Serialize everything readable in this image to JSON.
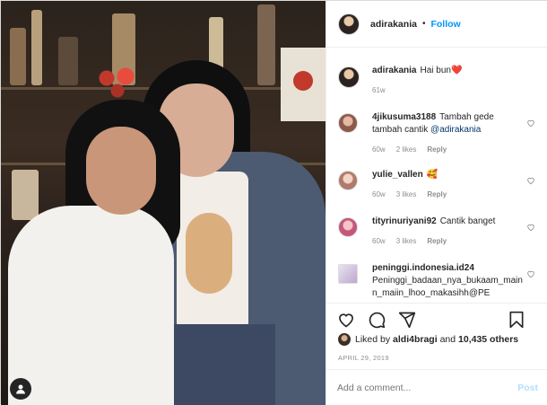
{
  "header": {
    "username": "adirakania",
    "separator": "•",
    "follow_label": "Follow"
  },
  "caption": {
    "username": "adirakania",
    "text": "Hai bun",
    "emoji": "❤️",
    "time": "61w"
  },
  "comments": [
    {
      "username": "4jikusuma3188",
      "text": "Tambah gede tambah cantik",
      "mention": "@adirakania",
      "time": "60w",
      "likes": "2 likes",
      "reply": "Reply"
    },
    {
      "username": "yulie_vallen",
      "text": "🥰",
      "time": "60w",
      "likes": "3 likes",
      "reply": "Reply"
    },
    {
      "username": "tityrinuriyani92",
      "text": "Cantik banget",
      "time": "60w",
      "likes": "3 likes",
      "reply": "Reply"
    },
    {
      "username": "peninggi.indonesia.id24",
      "text": "Peninggi_badaan_nya_bukaam_mainn_maiin_lhoo_makasihh@PE"
    }
  ],
  "likes": {
    "prefix": "Liked by",
    "user": "aldi4bragi",
    "joiner": "and",
    "count": "10,435 others"
  },
  "date": "APRIL 29, 2019",
  "add_comment": {
    "placeholder": "Add a comment...",
    "post_label": "Post"
  },
  "colors": {
    "accent": "#0095f6",
    "post_disabled": "#b2dffc",
    "mention": "#00376b",
    "meta": "#8e8e8e",
    "heart": "#ed4956"
  },
  "icons": [
    "heart-icon",
    "comment-icon",
    "share-icon",
    "bookmark-icon",
    "user-tag-icon",
    "like-heart-icon"
  ]
}
